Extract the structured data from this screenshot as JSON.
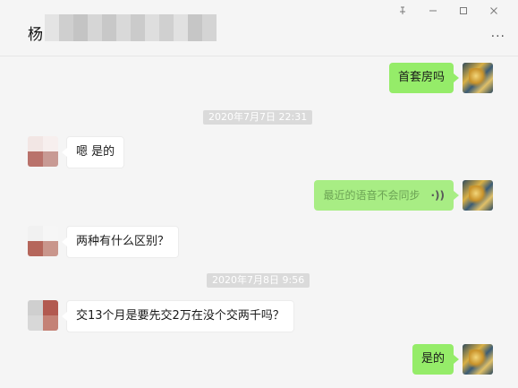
{
  "header": {
    "contact_name": "杨",
    "window_controls": [
      "pin-icon",
      "minimize-icon",
      "maximize-icon",
      "close-icon"
    ],
    "more_label": "···"
  },
  "messages": [
    {
      "type": "out",
      "text": "首套房吗"
    },
    {
      "type": "time",
      "text": "2020年7月7日 22:31"
    },
    {
      "type": "in",
      "text": "嗯  是的"
    },
    {
      "type": "out-voice",
      "text": "最近的语音不会同步"
    },
    {
      "type": "in",
      "text": "两种有什么区别？"
    },
    {
      "type": "time",
      "text": "2020年7月8日 9:56"
    },
    {
      "type": "in",
      "text": "交13个月是要先交2万在没个交两千吗？"
    },
    {
      "type": "out",
      "text": "是的"
    }
  ],
  "colors": {
    "outgoing_bubble": "#95ec69",
    "incoming_bubble": "#ffffff",
    "background": "#f5f5f5",
    "timestamp_bg": "#dadada"
  }
}
